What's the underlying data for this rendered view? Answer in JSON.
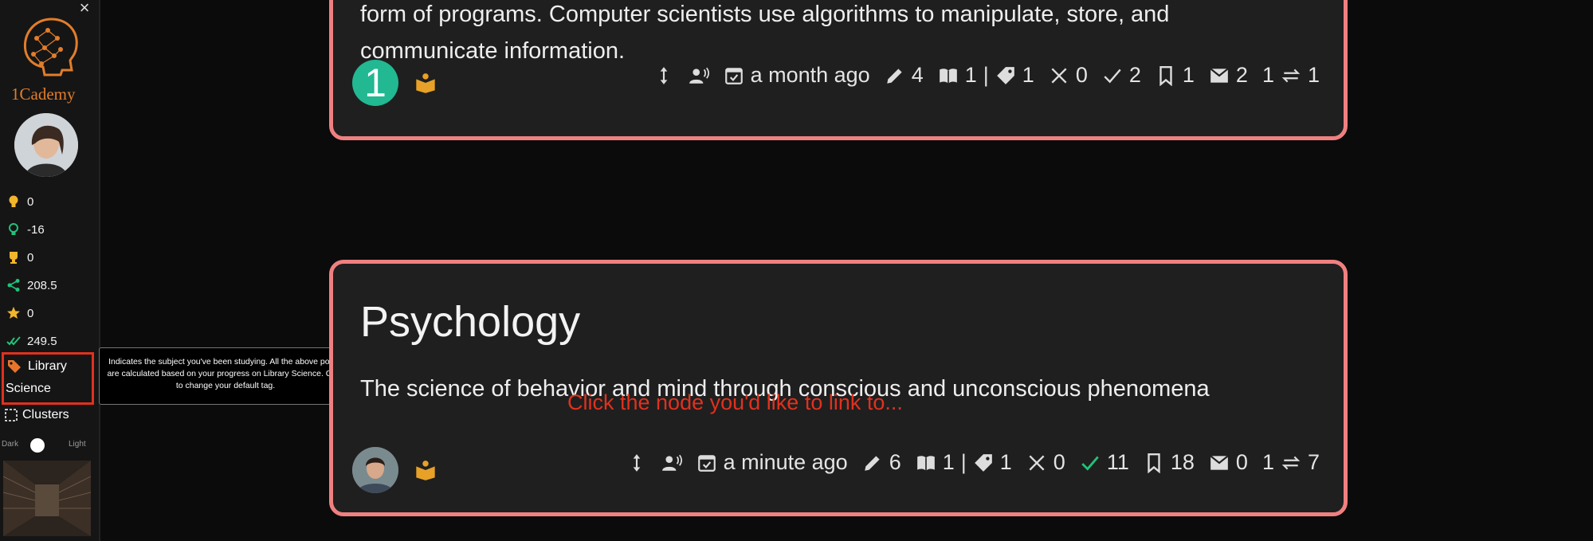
{
  "sidebar": {
    "brand": "1Cademy",
    "stats": [
      {
        "icon": "bulb-icon",
        "value": "0"
      },
      {
        "icon": "bulb-outline-icon",
        "value": "-16"
      },
      {
        "icon": "trophy-icon",
        "value": "0"
      },
      {
        "icon": "share-icon",
        "value": "208.5"
      },
      {
        "icon": "star-icon",
        "value": "0"
      },
      {
        "icon": "double-check-icon",
        "value": "249.5"
      }
    ],
    "tag_line1": "Library",
    "tag_line2": "Science",
    "clusters_label": "Clusters",
    "theme_dark": "Dark",
    "theme_light": "Light"
  },
  "tooltip": "Indicates the subject you've been studying. All the above points are calculated based on your progress on Library Science. Click to change your default tag.",
  "cards": [
    {
      "title": "",
      "description": "form of programs. Computer scientists use algorithms to manipulate, store, and communicate information.",
      "badge": "1",
      "time": "a month ago",
      "edits": "4",
      "refs": "1",
      "tags": "1",
      "wrong": "0",
      "correct": "2",
      "bookmarks": "1",
      "messages": "2",
      "links_left": "1",
      "links_right": "1"
    },
    {
      "title": "Psychology",
      "description": "The science of behavior and mind through conscious and unconscious phenomena",
      "time": "a minute ago",
      "edits": "6",
      "refs": "1",
      "tags": "1",
      "wrong": "0",
      "correct": "11",
      "bookmarks": "18",
      "messages": "0",
      "links_left": "1",
      "links_right": "7"
    }
  ],
  "hint": "Click the node you'd like to link to...",
  "colors": {
    "card_border": "#f08080",
    "accent_orange": "#e8a128",
    "accent_green": "#22c27a",
    "hint_red": "#e0311e"
  }
}
